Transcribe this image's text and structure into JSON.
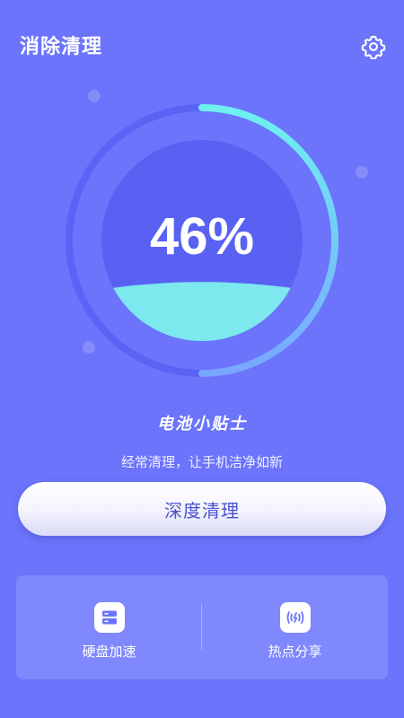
{
  "header": {
    "title": "消除清理",
    "settings_icon": "gear-icon"
  },
  "gauge": {
    "percent_text": "46%",
    "level": 0.46,
    "colors": {
      "ring_bg": "#5a63f4",
      "ring_fg": "#6fe6f2",
      "inner": "#5961f3",
      "wave": "#7de8ee"
    }
  },
  "tip": {
    "title": "电池小贴士",
    "subtitle": "经常清理，让手机洁净如新"
  },
  "primary_action": {
    "label": "深度清理"
  },
  "tools": [
    {
      "label": "硬盘加速",
      "icon": "storage-icon"
    },
    {
      "label": "热点分享",
      "icon": "hotspot-icon"
    }
  ],
  "colors": {
    "background": "#6b74fb",
    "accent": "#4b50d0"
  }
}
